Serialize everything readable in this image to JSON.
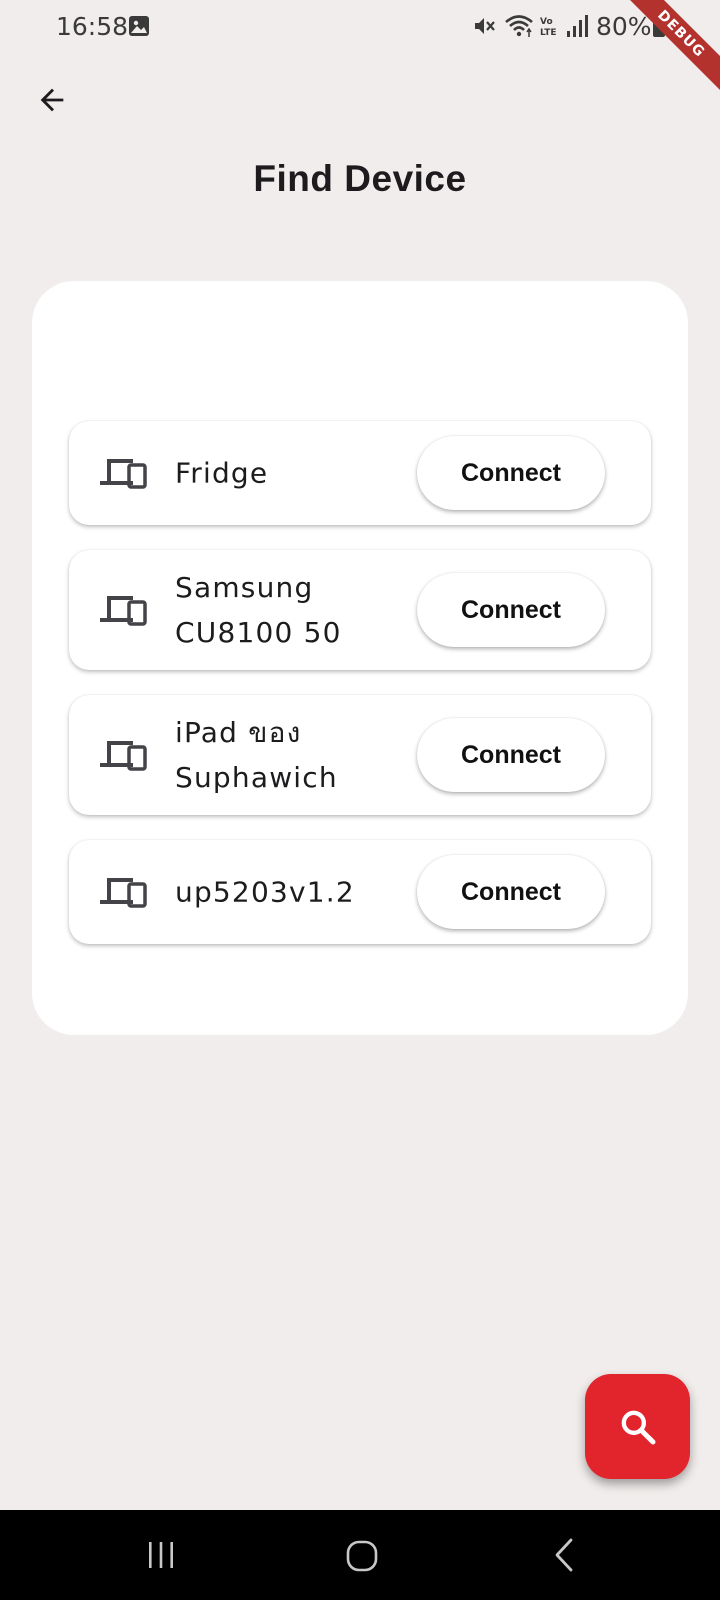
{
  "status_bar": {
    "time": "16:58",
    "battery": "80%",
    "icons": [
      "gallery-icon",
      "mute-icon",
      "wifi-icon",
      "volte-icon",
      "signal-icon",
      "battery-icon"
    ]
  },
  "debug_banner": "DEBUG",
  "app_bar": {
    "back_icon": "arrow-back-icon",
    "title": "Find Device"
  },
  "devices": [
    {
      "name": "Fridge",
      "button_label": "Connect",
      "icon": "devices-icon"
    },
    {
      "name": "Samsung\nCU8100 50",
      "button_label": "Connect",
      "icon": "devices-icon"
    },
    {
      "name": "iPad ของ\nSuphawich",
      "button_label": "Connect",
      "icon": "devices-icon"
    },
    {
      "name": "up5203v1.2",
      "button_label": "Connect",
      "icon": "devices-icon"
    }
  ],
  "fab": {
    "icon": "search-icon"
  },
  "nav_bar": {
    "icons": [
      "recents-icon",
      "home-icon",
      "back-icon"
    ]
  },
  "colors": {
    "background": "#f1edec",
    "card": "#ffffff",
    "accent": "#e2242c",
    "debug_ribbon": "#b3322e"
  }
}
